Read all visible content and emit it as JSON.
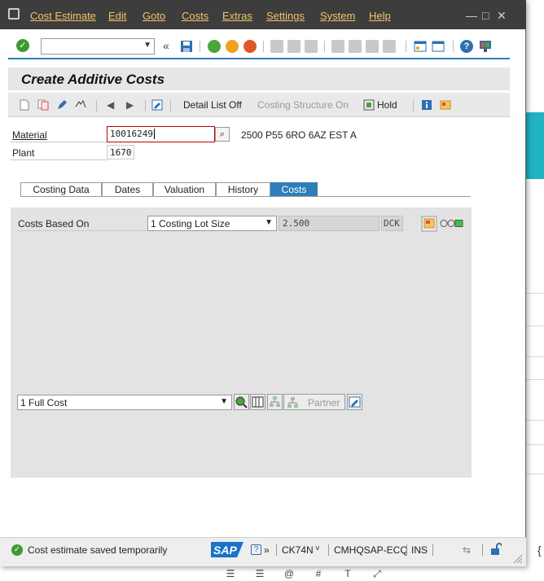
{
  "menu": {
    "items": [
      "Cost Estimate",
      "Edit",
      "Goto",
      "Costs",
      "Extras",
      "Settings",
      "System",
      "Help"
    ]
  },
  "toolbar": {
    "command_value": "",
    "back_glyph": "«"
  },
  "header": {
    "title": "Create Additive Costs"
  },
  "app_toolbar": {
    "detail_list": "Detail List Off",
    "costing_structure": "Costing Structure On",
    "hold": "Hold"
  },
  "form": {
    "material_label": "Material",
    "material_value": "10016249",
    "material_desc": "2500 P55 6RO 6AZ EST A",
    "plant_label": "Plant",
    "plant_value": "1670"
  },
  "tabs": [
    "Costing Data",
    "Dates",
    "Valuation",
    "History",
    "Costs"
  ],
  "active_tab": "Costs",
  "costs": {
    "based_on_label": "Costs Based On",
    "based_on_value": "1 Costing Lot Size",
    "lot_size": "2.500",
    "unit": "DCK",
    "view_value": "1 Full Cost",
    "partner": "Partner"
  },
  "status": {
    "message": "Cost estimate saved temporarily",
    "sap_logo": "SAP",
    "transaction": "CK74N",
    "system": "CMHQSAP-ECQ",
    "mode": "INS"
  },
  "colors": {
    "menubar_bg": "#3d3d3d",
    "menu_text": "#f3c567",
    "tab_active": "#2e7fb8",
    "ok_green": "#3d9a2f",
    "sap_blue": "#1a73c8"
  }
}
